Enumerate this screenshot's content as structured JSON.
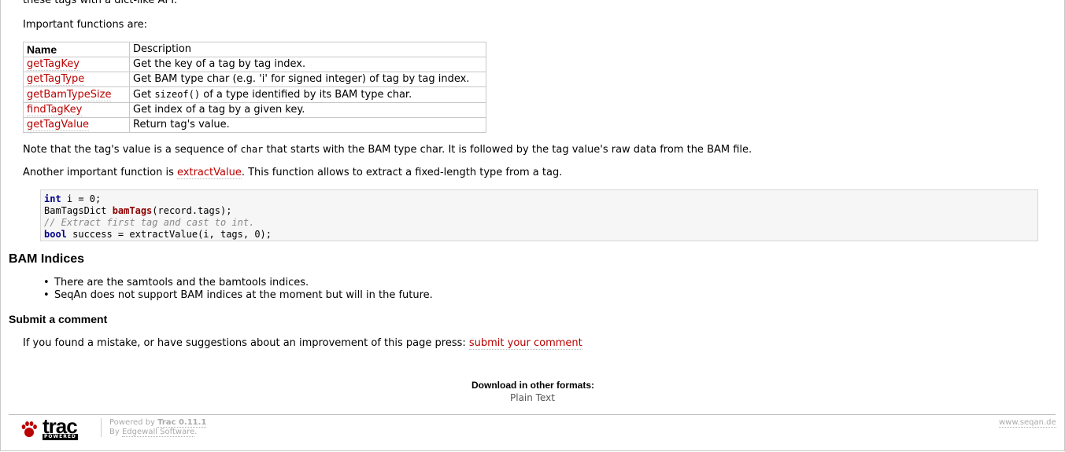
{
  "intro_cut": "these tags with a dict-like API.",
  "important_label": "Important functions are:",
  "table": {
    "headers": [
      "Name",
      "Description"
    ],
    "rows": [
      {
        "name": "getTagKey",
        "desc": "Get the key of a tag by tag index."
      },
      {
        "name": "getTagType",
        "desc": "Get BAM type char (e.g. 'i' for signed integer) of tag by tag index."
      },
      {
        "name": "getBamTypeSize",
        "desc_pre": "Get ",
        "desc_code": "sizeof()",
        "desc_post": " of a type identified by its BAM type char."
      },
      {
        "name": "findTagKey",
        "desc": "Get index of a tag by a given key."
      },
      {
        "name": "getTagValue",
        "desc": "Return tag's value."
      }
    ]
  },
  "note": {
    "pre": "Note that the tag's value is a sequence of ",
    "code": "char",
    "post": " that starts with the BAM type char. It is followed by the tag value's raw data from the BAM file."
  },
  "another": {
    "pre": "Another important function is ",
    "link": "extractValue",
    "post": ". This function allows to extract a fixed-length type from a tag."
  },
  "code": {
    "l1_kw": "int",
    "l1_rest": " i = 0;",
    "l2_pre": "BamTagsDict ",
    "l2_fn": "bamTags",
    "l2_post": "(record.tags);",
    "l3_comment": "// Extract first tag and cast to int.",
    "l4_kw": "bool",
    "l4_rest": " success = extractValue(i, tags, 0);"
  },
  "bam_indices": {
    "title": "BAM Indices",
    "items": [
      "There are the samtools and the bamtools indices.",
      "SeqAn does not support BAM indices at the moment but will in the future."
    ]
  },
  "submit": {
    "title": "Submit a comment",
    "text": "If you found a mistake, or have suggestions about an improvement of this page press: ",
    "link": "submit your comment"
  },
  "download": {
    "heading": "Download in other formats:",
    "plain_text": "Plain Text"
  },
  "footer": {
    "logo_word": "trac",
    "logo_tag": "POWERED",
    "powered_by": "Powered by ",
    "trac_version": "Trac 0.11.1",
    "by": "By ",
    "edgewall": "Edgewall Software",
    "by_end": ".",
    "site": "www.seqan.de"
  }
}
